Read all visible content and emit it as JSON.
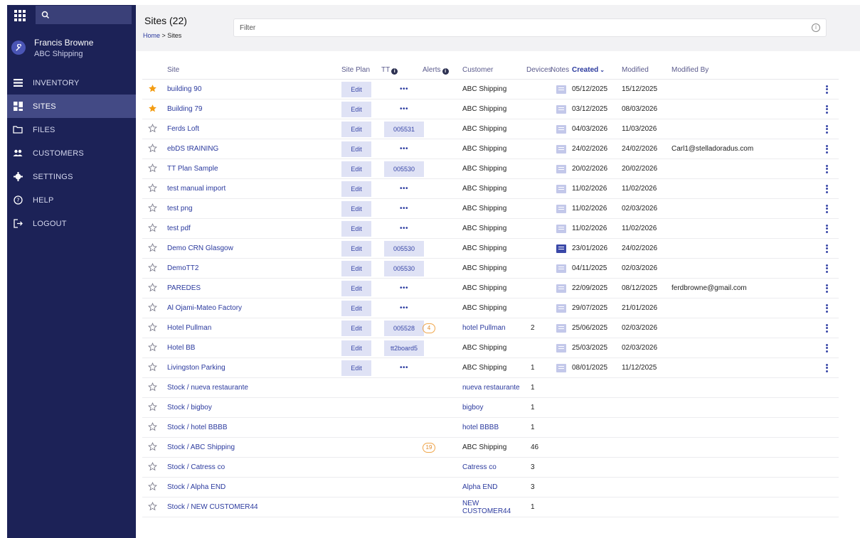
{
  "sidebar": {
    "user_name": "Francis Browne",
    "user_org": "ABC Shipping",
    "items": [
      {
        "label": "INVENTORY",
        "icon": "list-icon",
        "active": false
      },
      {
        "label": "SITES",
        "icon": "sites-icon",
        "active": true
      },
      {
        "label": "FILES",
        "icon": "folder-icon",
        "active": false
      },
      {
        "label": "CUSTOMERS",
        "icon": "people-icon",
        "active": false
      },
      {
        "label": "SETTINGS",
        "icon": "gear-icon",
        "active": false
      },
      {
        "label": "HELP",
        "icon": "help-icon",
        "active": false
      },
      {
        "label": "LOGOUT",
        "icon": "logout-icon",
        "active": false
      }
    ]
  },
  "header": {
    "title": "Sites (22)",
    "breadcrumb_home": "Home",
    "breadcrumb_sep": " > ",
    "breadcrumb_current": "Sites",
    "filter_placeholder": "Filter"
  },
  "table": {
    "columns": {
      "site": "Site",
      "site_plan": "Site Plan",
      "tt": "TT",
      "alerts": "Alerts",
      "customer": "Customer",
      "devices": "Devices",
      "notes": "Notes",
      "created": "Created",
      "modified": "Modified",
      "modified_by": "Modified By"
    },
    "edit_label": "Edit",
    "dots_label": "•••",
    "rows": [
      {
        "starred": true,
        "site": "building 90",
        "edit": true,
        "tt": "",
        "alerts": "",
        "customer": "ABC Shipping",
        "customer_link": false,
        "devices": "",
        "notes": true,
        "note_active": false,
        "created": "05/12/2025",
        "modified": "15/12/2025",
        "modified_by": "",
        "menu": true
      },
      {
        "starred": true,
        "site": "Building 79",
        "edit": true,
        "tt": "",
        "alerts": "",
        "customer": "ABC Shipping",
        "customer_link": false,
        "devices": "",
        "notes": true,
        "note_active": false,
        "created": "03/12/2025",
        "modified": "08/03/2026",
        "modified_by": "",
        "menu": true
      },
      {
        "starred": false,
        "site": "Ferds Loft",
        "edit": true,
        "tt": "005531",
        "alerts": "",
        "customer": "ABC Shipping",
        "customer_link": false,
        "devices": "",
        "notes": true,
        "note_active": false,
        "created": "04/03/2026",
        "modified": "11/03/2026",
        "modified_by": "",
        "menu": true
      },
      {
        "starred": false,
        "site": "ebDS tRAINING",
        "edit": true,
        "tt": "",
        "alerts": "",
        "customer": "ABC Shipping",
        "customer_link": false,
        "devices": "",
        "notes": true,
        "note_active": false,
        "created": "24/02/2026",
        "modified": "24/02/2026",
        "modified_by": "Carl1@stelladoradus.com",
        "menu": true
      },
      {
        "starred": false,
        "site": "TT Plan Sample",
        "edit": true,
        "tt": "005530",
        "alerts": "",
        "customer": "ABC Shipping",
        "customer_link": false,
        "devices": "",
        "notes": true,
        "note_active": false,
        "created": "20/02/2026",
        "modified": "20/02/2026",
        "modified_by": "",
        "menu": true
      },
      {
        "starred": false,
        "site": "test manual import",
        "edit": true,
        "tt": "",
        "alerts": "",
        "customer": "ABC Shipping",
        "customer_link": false,
        "devices": "",
        "notes": true,
        "note_active": false,
        "created": "11/02/2026",
        "modified": "11/02/2026",
        "modified_by": "",
        "menu": true
      },
      {
        "starred": false,
        "site": "test png",
        "edit": true,
        "tt": "",
        "alerts": "",
        "customer": "ABC Shipping",
        "customer_link": false,
        "devices": "",
        "notes": true,
        "note_active": false,
        "created": "11/02/2026",
        "modified": "02/03/2026",
        "modified_by": "",
        "menu": true
      },
      {
        "starred": false,
        "site": "test pdf",
        "edit": true,
        "tt": "",
        "alerts": "",
        "customer": "ABC Shipping",
        "customer_link": false,
        "devices": "",
        "notes": true,
        "note_active": false,
        "created": "11/02/2026",
        "modified": "11/02/2026",
        "modified_by": "",
        "menu": true
      },
      {
        "starred": false,
        "site": "Demo CRN Glasgow",
        "edit": true,
        "tt": "005530",
        "alerts": "",
        "customer": "ABC Shipping",
        "customer_link": false,
        "devices": "",
        "notes": true,
        "note_active": true,
        "created": "23/01/2026",
        "modified": "24/02/2026",
        "modified_by": "",
        "menu": true
      },
      {
        "starred": false,
        "site": "DemoTT2",
        "edit": true,
        "tt": "005530",
        "alerts": "",
        "customer": "ABC Shipping",
        "customer_link": false,
        "devices": "",
        "notes": true,
        "note_active": false,
        "created": "04/11/2025",
        "modified": "02/03/2026",
        "modified_by": "",
        "menu": true
      },
      {
        "starred": false,
        "site": "PAREDES",
        "edit": true,
        "tt": "",
        "alerts": "",
        "customer": "ABC Shipping",
        "customer_link": false,
        "devices": "",
        "notes": true,
        "note_active": false,
        "created": "22/09/2025",
        "modified": "08/12/2025",
        "modified_by": "ferdbrowne@gmail.com",
        "menu": true
      },
      {
        "starred": false,
        "site": "Al Ojami-Mateo Factory",
        "edit": true,
        "tt": "",
        "alerts": "",
        "customer": "ABC Shipping",
        "customer_link": false,
        "devices": "",
        "notes": true,
        "note_active": false,
        "created": "29/07/2025",
        "modified": "21/01/2026",
        "modified_by": "",
        "menu": true
      },
      {
        "starred": false,
        "site": "Hotel Pullman",
        "edit": true,
        "tt": "005528",
        "alerts": "4",
        "customer": "hotel Pullman",
        "customer_link": true,
        "devices": "2",
        "notes": true,
        "note_active": false,
        "created": "25/06/2025",
        "modified": "02/03/2026",
        "modified_by": "",
        "menu": true
      },
      {
        "starred": false,
        "site": "Hotel BB",
        "edit": true,
        "tt": "tt2board5",
        "alerts": "",
        "customer": "ABC Shipping",
        "customer_link": false,
        "devices": "",
        "notes": true,
        "note_active": false,
        "created": "25/03/2025",
        "modified": "02/03/2026",
        "modified_by": "",
        "menu": true
      },
      {
        "starred": false,
        "site": "Livingston Parking",
        "edit": true,
        "tt": "",
        "alerts": "",
        "customer": "ABC Shipping",
        "customer_link": false,
        "devices": "1",
        "notes": true,
        "note_active": false,
        "created": "08/01/2025",
        "modified": "11/12/2025",
        "modified_by": "",
        "menu": true
      },
      {
        "starred": false,
        "site": "Stock / nueva restaurante",
        "edit": false,
        "tt": null,
        "alerts": "",
        "customer": "nueva restaurante",
        "customer_link": true,
        "devices": "1",
        "notes": false,
        "note_active": false,
        "created": "",
        "modified": "",
        "modified_by": "",
        "menu": false
      },
      {
        "starred": false,
        "site": "Stock / bigboy",
        "edit": false,
        "tt": null,
        "alerts": "",
        "customer": "bigboy",
        "customer_link": true,
        "devices": "1",
        "notes": false,
        "note_active": false,
        "created": "",
        "modified": "",
        "modified_by": "",
        "menu": false
      },
      {
        "starred": false,
        "site": "Stock / hotel BBBB",
        "edit": false,
        "tt": null,
        "alerts": "",
        "customer": "hotel BBBB",
        "customer_link": true,
        "devices": "1",
        "notes": false,
        "note_active": false,
        "created": "",
        "modified": "",
        "modified_by": "",
        "menu": false
      },
      {
        "starred": false,
        "site": "Stock / ABC Shipping",
        "edit": false,
        "tt": null,
        "alerts": "19",
        "customer": "ABC Shipping",
        "customer_link": false,
        "devices": "46",
        "notes": false,
        "note_active": false,
        "created": "",
        "modified": "",
        "modified_by": "",
        "menu": false
      },
      {
        "starred": false,
        "site": "Stock / Catress co",
        "edit": false,
        "tt": null,
        "alerts": "",
        "customer": "Catress co",
        "customer_link": true,
        "devices": "3",
        "notes": false,
        "note_active": false,
        "created": "",
        "modified": "",
        "modified_by": "",
        "menu": false
      },
      {
        "starred": false,
        "site": "Stock / Alpha END",
        "edit": false,
        "tt": null,
        "alerts": "",
        "customer": "Alpha END",
        "customer_link": true,
        "devices": "3",
        "notes": false,
        "note_active": false,
        "created": "",
        "modified": "",
        "modified_by": "",
        "menu": false
      },
      {
        "starred": false,
        "site": "Stock / NEW CUSTOMER44",
        "edit": false,
        "tt": null,
        "alerts": "",
        "customer": "NEW CUSTOMER44",
        "customer_link": true,
        "devices": "1",
        "notes": false,
        "note_active": false,
        "created": "",
        "modified": "",
        "modified_by": "",
        "menu": false
      }
    ]
  },
  "colors": {
    "sidebar_bg": "#1c2257",
    "sidebar_active": "#434a85",
    "accent": "#2b3a9e",
    "star_filled": "#f39c12",
    "alert_orange": "#e08a2a"
  }
}
